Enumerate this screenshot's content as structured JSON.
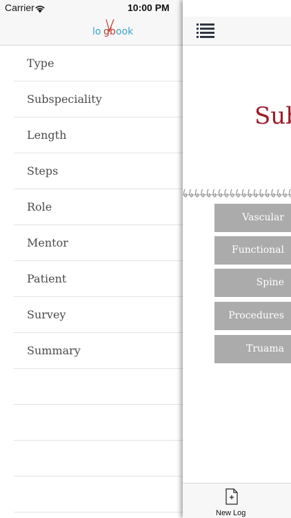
{
  "status_bar": {
    "carrier": "Carrier",
    "time": "10:00 PM"
  },
  "menu": {
    "items": [
      {
        "label": "Type"
      },
      {
        "label": "Subspeciality"
      },
      {
        "label": "Length"
      },
      {
        "label": "Steps"
      },
      {
        "label": "Role"
      },
      {
        "label": "Mentor"
      },
      {
        "label": "Patient"
      },
      {
        "label": "Survey"
      },
      {
        "label": "Summary"
      }
    ]
  },
  "logo": {
    "text_parts": [
      "lo",
      "g",
      "b",
      "ook"
    ]
  },
  "right_panel": {
    "title": "Sub",
    "title_color": "#9c1c2b",
    "categories": [
      "Vascular",
      "Functional",
      "Spine",
      "Procedures",
      "Truama"
    ],
    "tab": {
      "label": "New Log",
      "icon": "new-document-icon"
    }
  },
  "colors": {
    "button_bg": "#ababab",
    "logo_red": "#c0392b",
    "logo_blue": "#3ba3c9"
  }
}
